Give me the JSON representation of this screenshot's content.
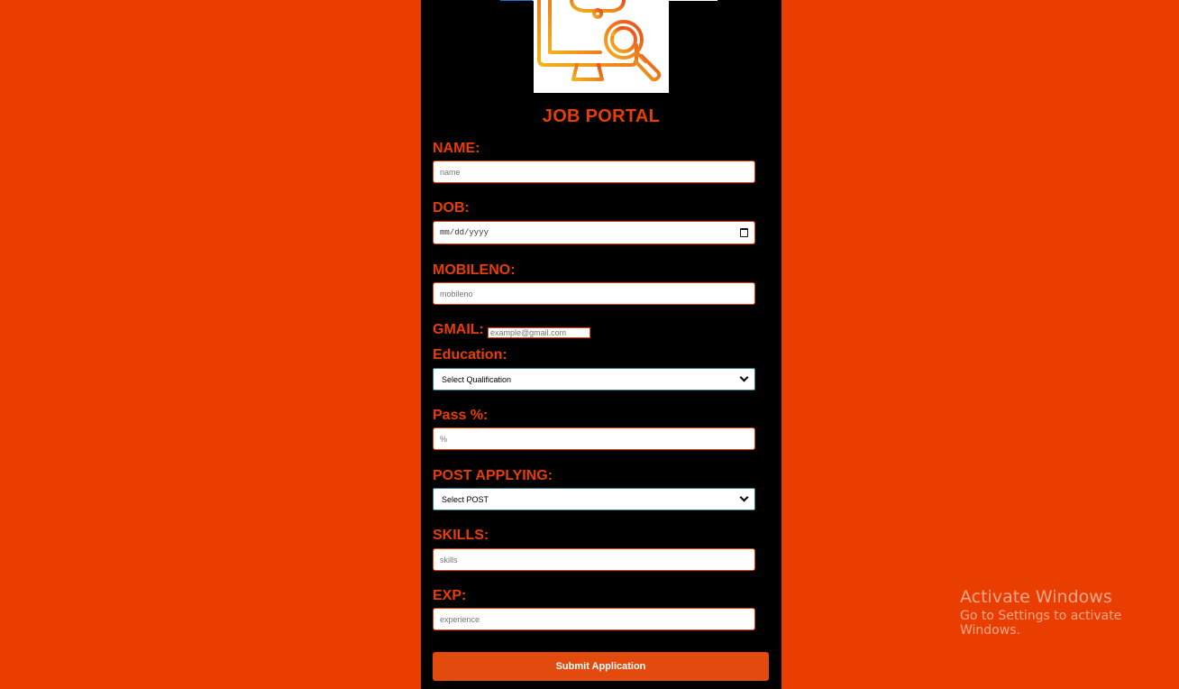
{
  "page": {
    "title": "JOB PORTAL"
  },
  "form": {
    "name_label": "NAME:",
    "name_placeholder": "name",
    "dob_label": "DOB:",
    "dob_placeholder": "mm/dd/yyyy",
    "mobile_label": "MOBILENO:",
    "mobile_placeholder": "mobileno",
    "gmail_label": "GMAIL:",
    "gmail_placeholder": "example@gmail.com",
    "education_label": "Education:",
    "education_selected": "Select Qualification",
    "pass_label": "Pass %:",
    "pass_placeholder": "%",
    "post_label": "POST APPLYING:",
    "post_selected": "Select POST",
    "skills_label": "SKILLS:",
    "skills_placeholder": "skills",
    "exp_label": "EXP:",
    "exp_placeholder": "experience",
    "submit_label": "Submit Application"
  },
  "watermark": {
    "line1": "Activate Windows",
    "line2": "Go to Settings to activate Windows."
  },
  "icons": {
    "logo": "computer-search-icon",
    "calendar": "calendar-icon",
    "dropdown": "chevron-down-icon"
  },
  "colors": {
    "accent": "#ea3e00",
    "panel": "#000000",
    "button": "#e34a0e",
    "logo_gradient_start": "#f2b31c",
    "logo_gradient_end": "#ea4a1c"
  }
}
